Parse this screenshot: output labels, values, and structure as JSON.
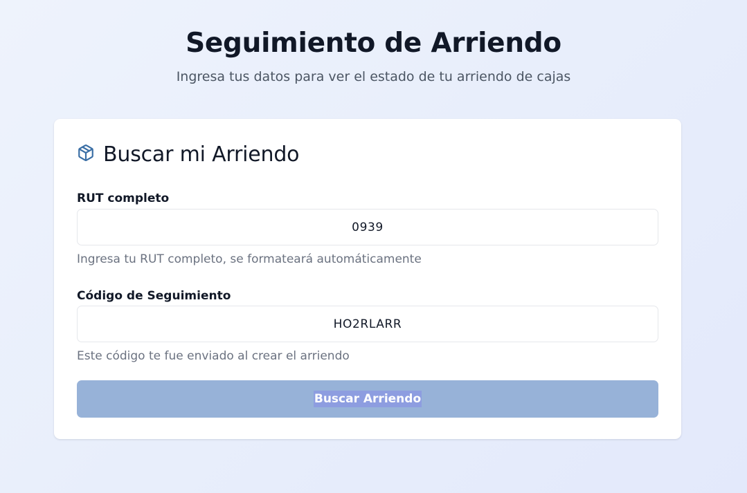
{
  "header": {
    "title": "Seguimiento de Arriendo",
    "subtitle": "Ingresa tus datos para ver el estado de tu arriendo de cajas"
  },
  "card": {
    "icon": "package-box-icon",
    "title": "Buscar mi Arriendo"
  },
  "form": {
    "rut": {
      "label": "RUT completo",
      "value": "0939",
      "help": "Ingresa tu RUT completo, se formateará automáticamente"
    },
    "code": {
      "label": "Código de Seguimiento",
      "value": "HO2RLARR",
      "help": "Este código te fue enviado al crear el arriendo"
    },
    "submit_label": "Buscar Arriendo"
  },
  "colors": {
    "accent_icon": "#3a6ea5",
    "button_disabled_bg": "#97b2d8",
    "text_primary": "#111827",
    "text_muted": "#6b7280"
  }
}
